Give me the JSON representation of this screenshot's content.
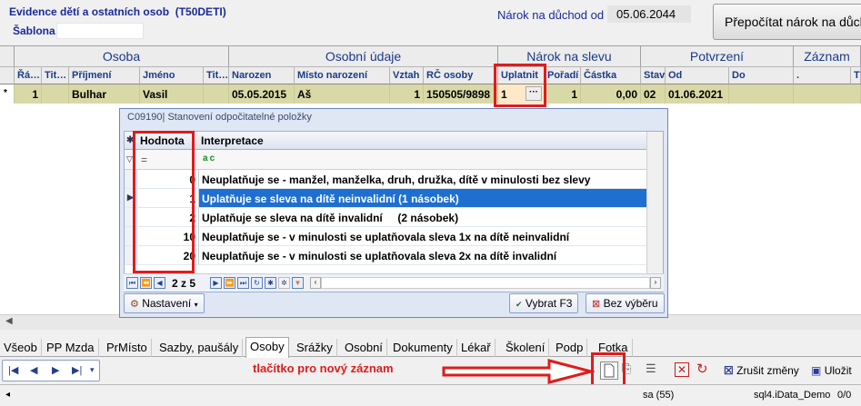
{
  "header": {
    "title": "Evidence dětí a ostatních osob",
    "code": "(T50DETI)",
    "sablona_label": "Šablona",
    "narok_label": "Nárok na důchod od",
    "narok_value": "05.06.2044",
    "recalc_button": "Přepočítat nárok na důchod"
  },
  "grid": {
    "groups": [
      "Osoba",
      "Osobní údaje",
      "Nárok na slevu",
      "Potvrzení",
      "Záznam"
    ],
    "columns": [
      "Řá…",
      "Tit…",
      "Příjmení",
      "Jméno",
      "Tit…",
      "Narozen",
      "Místo narození",
      "Vztah",
      "RČ osoby",
      "Uplatnit",
      "Pořadí",
      "Částka",
      "Stav",
      "Od",
      "Do",
      ".",
      "T"
    ],
    "row": {
      "indicator": "*",
      "rad": "1",
      "prijmeni": "Bulhar",
      "jmeno": "Vasil",
      "narozen": "05.05.2015",
      "misto": "Aš",
      "vztah": "1",
      "rc": "150505/9898",
      "uplatnit": "1",
      "uplatnit_btn": "···",
      "poradi": "1",
      "castka": "0,00",
      "stav": "02",
      "od": "01.06.2021"
    }
  },
  "popup": {
    "title": "C09190| Stanovení odpočitatelné položky",
    "col_value": "Hodnota",
    "col_interp": "Interpretace",
    "filter_eq": "=",
    "filter_abc": "a c",
    "rows": [
      {
        "value": "0",
        "text": "Neuplatňuje se - manžel, manželka, druh, družka, dítě v minulosti bez slevy"
      },
      {
        "value": "1",
        "text": "Uplatňuje se sleva na dítě neinvalidní (1 násobek)"
      },
      {
        "value": "2",
        "text": "Uplatňuje se sleva na dítě invalidní     (2 násobek)"
      },
      {
        "value": "10",
        "text": "Neuplatňuje se - v minulosti se uplatňovala sleva 1x na dítě neinvalidní"
      },
      {
        "value": "20",
        "text": "Neuplatňuje se - v minulosti se uplatňovala sleva 2x na dítě invalidní"
      }
    ],
    "selected_index": 1,
    "page_info": "2 z 5",
    "settings_button": "Nastavení",
    "select_button": "Vybrat F3",
    "no_select_button": "Bez výběru"
  },
  "tabs": [
    "Všeob",
    "PP Mzda",
    "PrMísto",
    "Sazby, paušály",
    "Osoby",
    "Srážky",
    "Osobní",
    "Dokumenty",
    "Lékař",
    "Školení",
    "Podp",
    "Fotka"
  ],
  "active_tab": "Osoby",
  "annotation": {
    "text": "tlačítko pro nový záznam",
    "color": "#e01b1b"
  },
  "toolbar": {
    "cancel_label": "Zrušit změny",
    "save_label": "Uložit"
  },
  "status": {
    "sa": "sa (55)",
    "db": "sql4.iData_Demo",
    "count": "0/0"
  },
  "colors": {
    "row_bg": "#d9d9a8",
    "selected_row": "#1e6fd0",
    "header_text": "#1a2a9a",
    "highlight": "#e01b1b"
  }
}
